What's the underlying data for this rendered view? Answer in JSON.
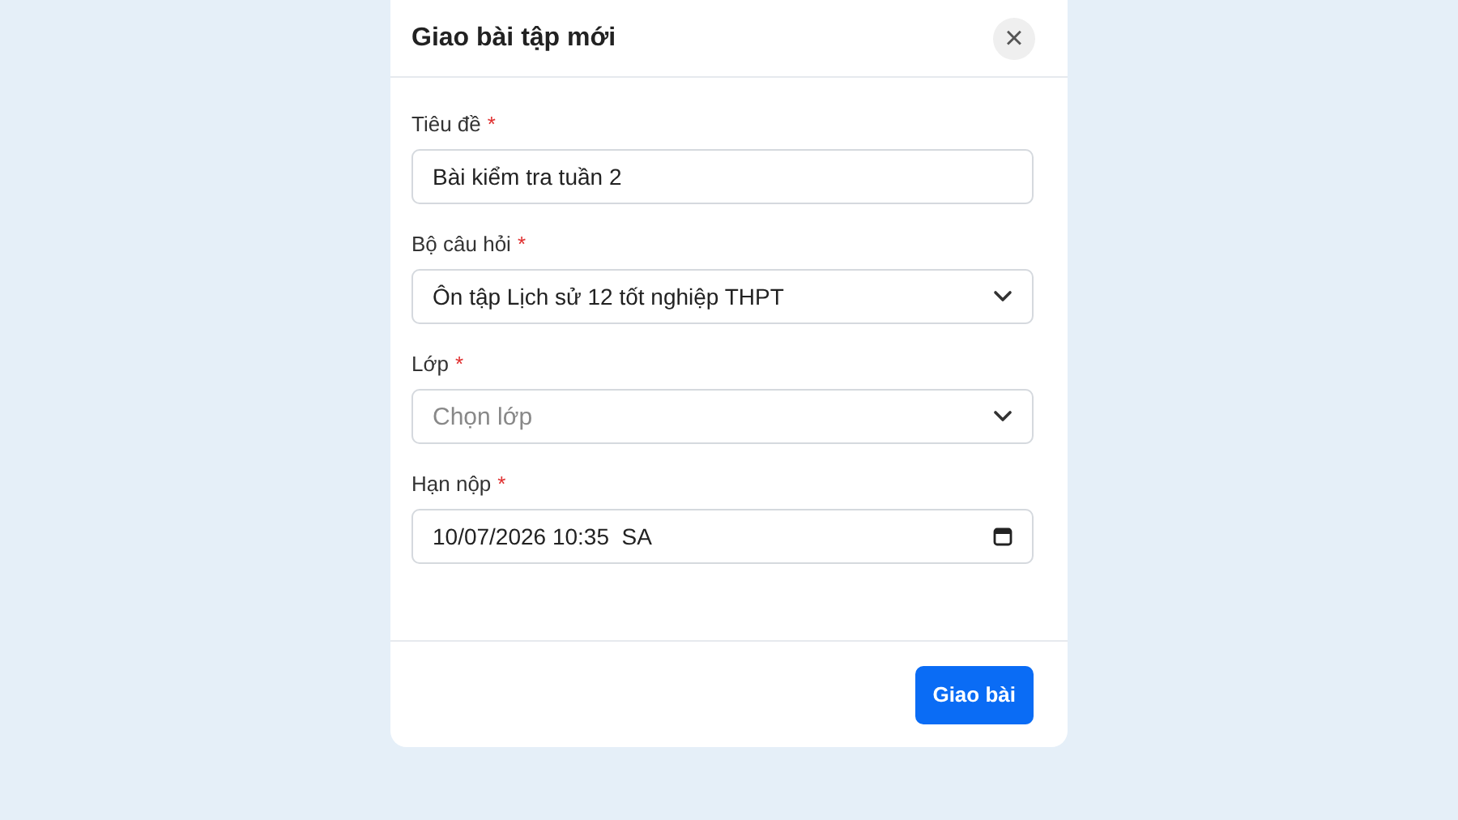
{
  "dialog": {
    "title": "Giao bài tập mới",
    "close": "×",
    "fields": [
      {
        "kind": "text",
        "label": "Tiêu đề",
        "required_mark": "*",
        "value": "Bài kiểm tra tuần 2"
      },
      {
        "kind": "select",
        "label": "Bộ câu hỏi",
        "required_mark": "*",
        "value": "Ôn tập Lịch sử 12 tốt nghiệp THPT"
      },
      {
        "kind": "select",
        "label": "Lớp",
        "required_mark": "*",
        "placeholder": "Chọn lớp"
      },
      {
        "kind": "datetime",
        "label": "Hạn nộp",
        "required_mark": "*",
        "value": "10/07/2026 10:35",
        "suffix": "SA"
      }
    ],
    "submit": "Giao bài"
  }
}
